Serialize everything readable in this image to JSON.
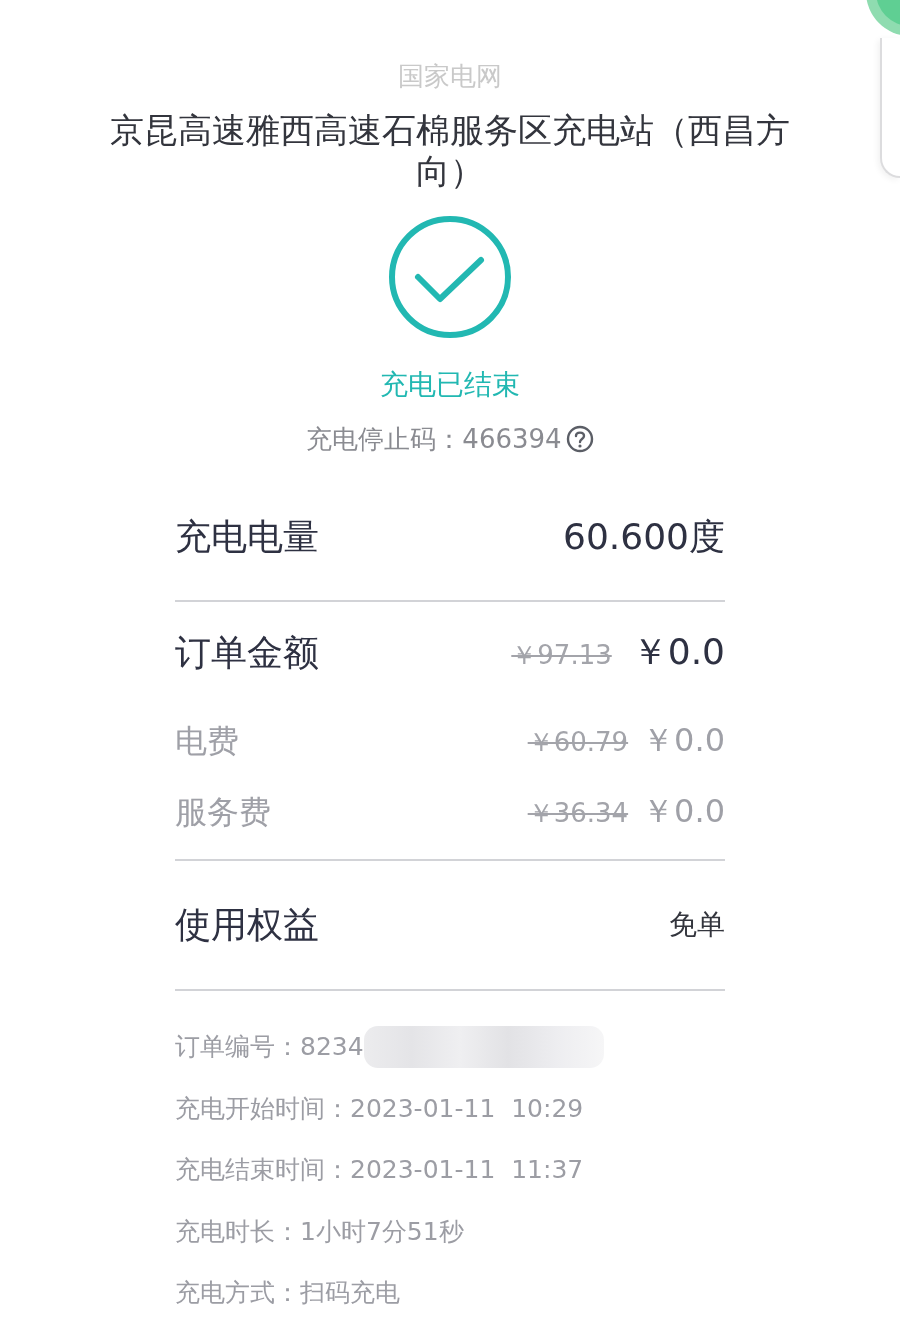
{
  "operator": "国家电网",
  "station": "京昆高速雅西高速石棉服务区充电站（西昌方向）",
  "status": {
    "text": "充电已结束",
    "stop_code_label": "充电停止码：",
    "stop_code": "466394"
  },
  "energy": {
    "label": "充电电量",
    "value": "60.600度"
  },
  "order_amount": {
    "label": "订单金额",
    "original": "￥97.13",
    "paid": "￥0.0"
  },
  "fees": [
    {
      "label": "电费",
      "original": "￥60.79",
      "paid": "￥0.0"
    },
    {
      "label": "服务费",
      "original": "￥36.34",
      "paid": "￥0.0"
    }
  ],
  "benefit": {
    "label": "使用权益",
    "value": "免单"
  },
  "details": [
    {
      "label": "订单编号：",
      "value": "8234",
      "redacted": true
    },
    {
      "label": "充电开始时间：",
      "value": "2023-01-11  10:29",
      "redacted": false
    },
    {
      "label": "充电结束时间：",
      "value": "2023-01-11  11:37",
      "redacted": false
    },
    {
      "label": "充电时长：",
      "value": "1小时7分51秒",
      "redacted": false
    },
    {
      "label": "充电方式：",
      "value": "扫码充电",
      "redacted": false
    }
  ]
}
